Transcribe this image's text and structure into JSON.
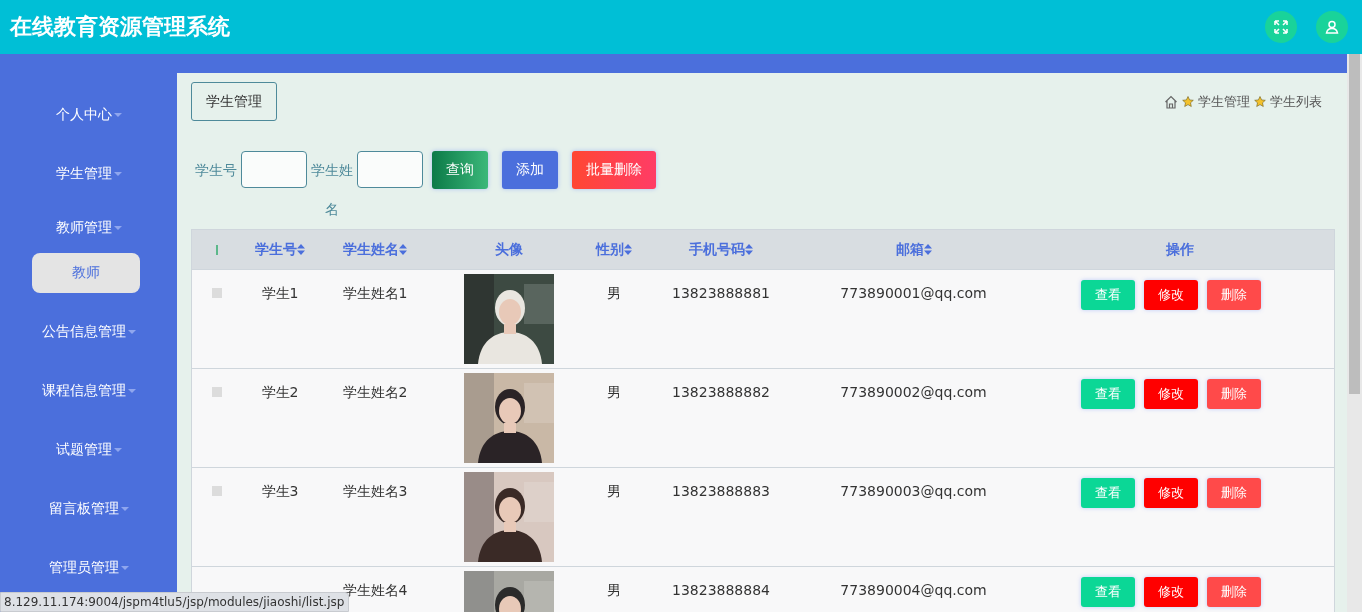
{
  "header": {
    "title": "在线教育资源管理系统"
  },
  "sidebar": {
    "items": [
      {
        "label": "个人中心"
      },
      {
        "label": "学生管理"
      },
      {
        "label": "教师管理",
        "children": [
          {
            "label": "教师",
            "hovered": true
          }
        ]
      },
      {
        "label": "公告信息管理"
      },
      {
        "label": "课程信息管理"
      },
      {
        "label": "试题管理"
      },
      {
        "label": "留言板管理"
      },
      {
        "label": "管理员管理"
      }
    ]
  },
  "page_tab": "学生管理",
  "breadcrumb": [
    "学生管理",
    "学生列表"
  ],
  "search": {
    "fields": [
      {
        "label": "学生号"
      },
      {
        "label": "学生姓名"
      }
    ],
    "buttons": [
      {
        "label": "查询",
        "kind": "search"
      },
      {
        "label": "添加",
        "kind": "add"
      },
      {
        "label": "批量删除",
        "kind": "batch-delete"
      }
    ]
  },
  "table": {
    "columns": [
      {
        "kind": "check",
        "checked": false
      },
      {
        "label": "学生号",
        "sortable": true
      },
      {
        "label": "学生姓名",
        "sortable": true
      },
      {
        "label": "头像",
        "sortable": false
      },
      {
        "label": "性别",
        "sortable": true
      },
      {
        "label": "手机号码",
        "sortable": true
      },
      {
        "label": "邮箱",
        "sortable": true
      },
      {
        "label": "操作",
        "sortable": false
      }
    ],
    "rows": [
      {
        "checked": false,
        "id": "学生1",
        "name": "学生姓名1",
        "avatar": {
          "kind": "picture"
        },
        "gender": "男",
        "phone": "13823888881",
        "email": "773890001@qq.com",
        "actions": [
          {
            "label": "查看",
            "kind": "view"
          },
          {
            "label": "修改",
            "kind": "edit"
          },
          {
            "label": "删除",
            "kind": "delete"
          }
        ]
      },
      {
        "checked": false,
        "id": "学生2",
        "name": "学生姓名2",
        "avatar": {
          "kind": "picture"
        },
        "gender": "男",
        "phone": "13823888882",
        "email": "773890002@qq.com",
        "actions": [
          {
            "label": "查看",
            "kind": "view"
          },
          {
            "label": "修改",
            "kind": "edit"
          },
          {
            "label": "删除",
            "kind": "delete"
          }
        ]
      },
      {
        "checked": false,
        "id": "学生3",
        "name": "学生姓名3",
        "avatar": {
          "kind": "picture"
        },
        "gender": "男",
        "phone": "13823888883",
        "email": "773890003@qq.com",
        "actions": [
          {
            "label": "查看",
            "kind": "view"
          },
          {
            "label": "修改",
            "kind": "edit"
          },
          {
            "label": "删除",
            "kind": "delete"
          }
        ]
      },
      {
        "name": "学生姓名4",
        "avatar": {
          "kind": "picture"
        },
        "gender": "男",
        "phone": "13823888884",
        "email": "773890004@qq.com",
        "actions": [
          {
            "label": "查看",
            "kind": "view"
          },
          {
            "label": "修改",
            "kind": "edit"
          },
          {
            "label": "删除",
            "kind": "delete"
          }
        ]
      }
    ]
  },
  "status_bar": {
    "url": "8.129.11.174:9004/jspm4tlu5/jsp/modules/jiaoshi/list.jsp"
  }
}
